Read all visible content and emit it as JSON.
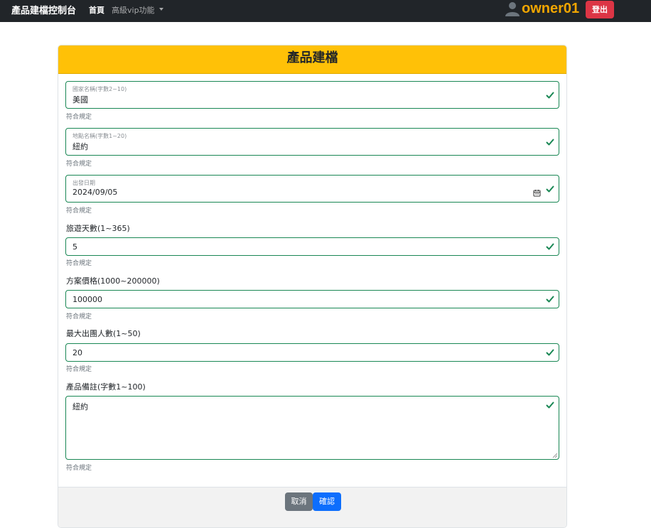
{
  "navbar": {
    "brand": "產品建檔控制台",
    "home": "首頁",
    "vip_menu": "高級vip功能",
    "username": "owner01",
    "logout": "登出"
  },
  "card": {
    "title": "產品建檔"
  },
  "form": {
    "country": {
      "label": "國家名稱(字數2~10)",
      "value": "美國",
      "feedback": "符合規定"
    },
    "location": {
      "label": "地點名稱(字數1~20)",
      "value": "紐約",
      "feedback": "符合規定"
    },
    "departure": {
      "label": "出發日期",
      "value": "2024/09/05",
      "feedback": "符合規定"
    },
    "days": {
      "label": "旅遊天數(1~365)",
      "value": "5",
      "feedback": "符合規定"
    },
    "price": {
      "label": "方案價格(1000~200000)",
      "value": "100000",
      "feedback": "符合規定"
    },
    "max_people": {
      "label": "最大出團人數(1~50)",
      "value": "20",
      "feedback": "符合規定"
    },
    "notes": {
      "label": "產品備註(字數1~100)",
      "value": "紐約",
      "feedback": "符合規定"
    }
  },
  "footer": {
    "cancel": "取消",
    "confirm": "確認"
  },
  "colors": {
    "navbar_bg": "#212529",
    "header_bg": "#ffc107",
    "valid": "#198754",
    "danger": "#dc3545",
    "primary": "#0d6efd",
    "secondary": "#6c757d",
    "username": "#f0a500"
  },
  "icons": {
    "user": "person-icon",
    "valid": "check-icon",
    "calendar": "calendar-icon"
  }
}
